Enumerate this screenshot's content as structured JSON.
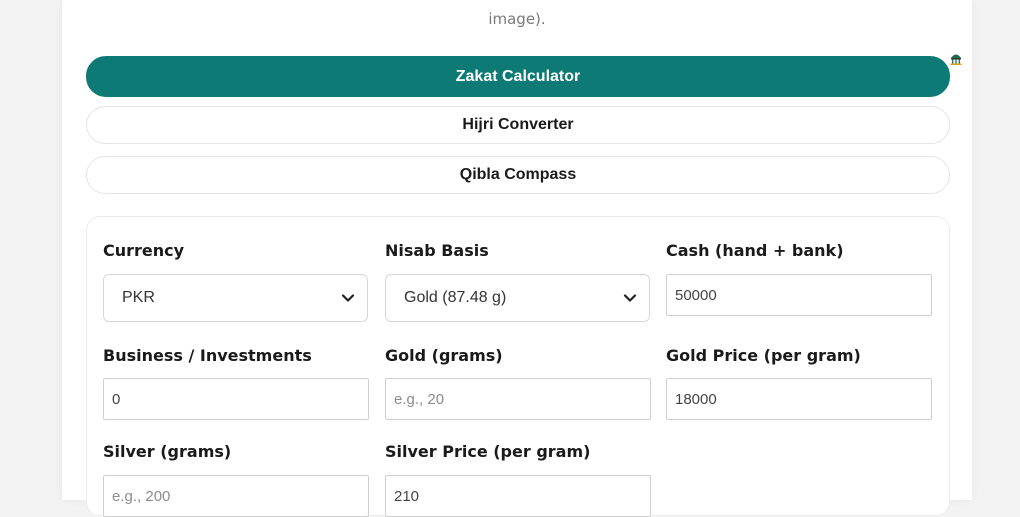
{
  "intro": {
    "tail_text": "image)."
  },
  "tabs": [
    {
      "label": "Zakat Calculator",
      "active": true
    },
    {
      "label": "Hijri Converter",
      "active": false
    },
    {
      "label": "Qibla Compass",
      "active": false
    }
  ],
  "colors": {
    "accent": "#0e7a76"
  },
  "form": {
    "currency": {
      "label": "Currency",
      "value": "PKR"
    },
    "nisab_basis": {
      "label": "Nisab Basis",
      "value": "Gold (87.48 g)"
    },
    "cash": {
      "label": "Cash (hand + bank)",
      "value": "50000"
    },
    "business": {
      "label": "Business / Investments",
      "value": "0"
    },
    "gold_grams": {
      "label": "Gold (grams)",
      "placeholder": "e.g., 20"
    },
    "gold_price": {
      "label": "Gold Price (per gram)",
      "value": "18000"
    },
    "silver_grams": {
      "label": "Silver (grams)",
      "placeholder": "e.g., 200"
    },
    "silver_price": {
      "label": "Silver Price (per gram)",
      "value": "210"
    }
  },
  "icons": {
    "corner": "mosque-icon",
    "select_arrow": "chevron-down-icon"
  }
}
